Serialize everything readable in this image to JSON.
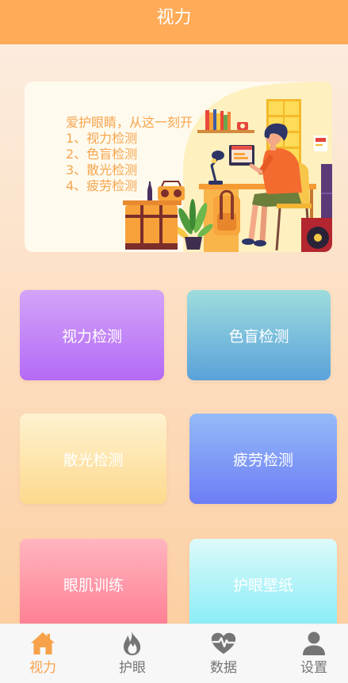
{
  "header": {
    "title": "视力",
    "background": "#FFAB58"
  },
  "banner": {
    "headline": "爱护眼睛，从这一刻开",
    "items": [
      "1、视力检测",
      "2、色盲检测",
      "3、散光检测",
      "4、疲劳检测"
    ],
    "text_color": "#F6A54D"
  },
  "tests": [
    {
      "label": "视力检测",
      "gradient": [
        "#D3A4F8",
        "#B46AF6"
      ]
    },
    {
      "label": "色盲检测",
      "gradient": [
        "#9EDDDC",
        "#5AA2DB"
      ]
    },
    {
      "label": "散光检测",
      "gradient": [
        "#FEF2D0",
        "#FDD98D"
      ]
    },
    {
      "label": "疲劳检测",
      "gradient": [
        "#94BBF8",
        "#6D7DF5"
      ]
    },
    {
      "label": "眼肌训练",
      "gradient": [
        "#FFB5BF",
        "#FF7D92"
      ]
    },
    {
      "label": "护眼壁纸",
      "gradient": [
        "#DDFAF9",
        "#86ECF7"
      ]
    }
  ],
  "nav": {
    "active_color": "#F7A24B",
    "inactive_color": "#757575",
    "items": [
      {
        "label": "视力",
        "icon": "home-icon",
        "active": true
      },
      {
        "label": "护眼",
        "icon": "flame-icon",
        "active": false
      },
      {
        "label": "数据",
        "icon": "heart-pulse-icon",
        "active": false
      },
      {
        "label": "设置",
        "icon": "user-icon",
        "active": false
      }
    ]
  }
}
